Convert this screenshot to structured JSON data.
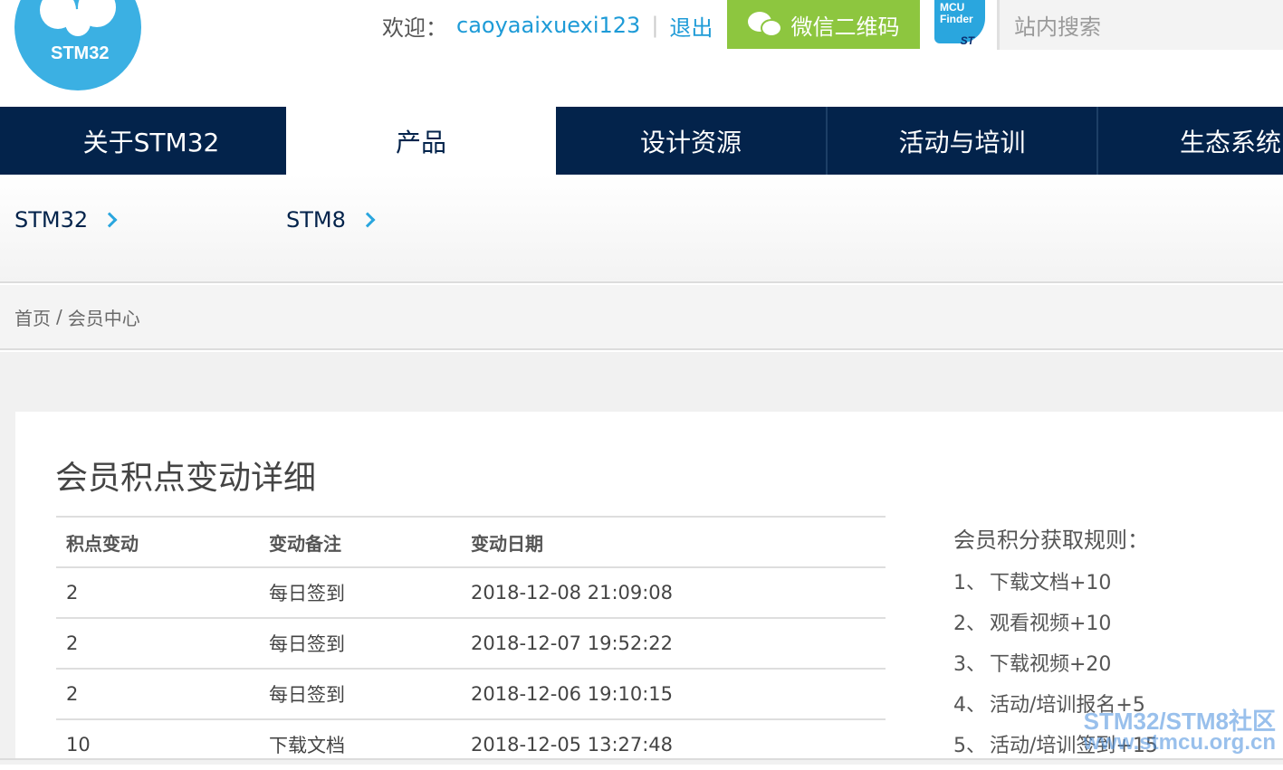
{
  "header": {
    "logo_text": "STM32",
    "welcome_label": "欢迎：",
    "username": "caoyaaixuexi123",
    "separator": "|",
    "logout": "退出",
    "wechat_button": "微信二维码",
    "mcu_finder_line1": "MCU",
    "mcu_finder_line2": "Finder",
    "mcu_finder_brand": "ST",
    "search_placeholder": "站内搜索"
  },
  "nav": {
    "items": [
      {
        "label": "关于STM32"
      },
      {
        "label": "产品"
      },
      {
        "label": "设计资源"
      },
      {
        "label": "活动与培训"
      },
      {
        "label": "生态系统"
      }
    ],
    "active_index": 1
  },
  "subnav": {
    "items": [
      {
        "label": "STM32"
      },
      {
        "label": "STM8"
      }
    ]
  },
  "breadcrumb": {
    "home": "首页",
    "separator": "/",
    "current": "会员中心"
  },
  "main": {
    "title": "会员积点变动详细",
    "table": {
      "columns": [
        "积点变动",
        "变动备注",
        "变动日期"
      ],
      "rows": [
        [
          "2",
          "每日签到",
          "2018-12-08 21:09:08"
        ],
        [
          "2",
          "每日签到",
          "2018-12-07 19:52:22"
        ],
        [
          "2",
          "每日签到",
          "2018-12-06 19:10:15"
        ],
        [
          "10",
          "下载文档",
          "2018-12-05 13:27:48"
        ]
      ]
    },
    "rules": {
      "title": "会员积分获取规则：",
      "items": [
        {
          "num": "1、",
          "text": "下载文档+10"
        },
        {
          "num": "2、",
          "text": "观看视频+10"
        },
        {
          "num": "3、",
          "text": "下载视频+20"
        },
        {
          "num": "4、",
          "text": "活动/培训报名+5"
        },
        {
          "num": "5、",
          "text": "活动/培训签到+15"
        }
      ]
    }
  },
  "watermark": {
    "line1": "STM32/STM8社区",
    "line2": "www.stmcu.org.cn"
  },
  "colors": {
    "nav_bg": "#03234b",
    "accent_blue": "#1e9bd7",
    "wechat_green": "#8dc63f",
    "logo_blue": "#3bb0e3"
  }
}
